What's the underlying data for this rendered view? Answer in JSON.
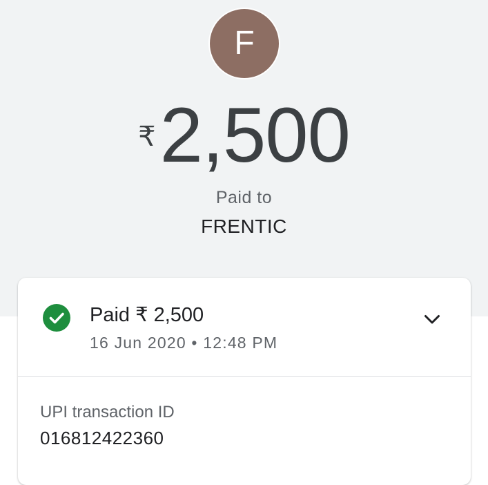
{
  "payee": {
    "avatar_initial": "F",
    "avatar_color": "#8d6e63",
    "name": "FRENTIC"
  },
  "payment": {
    "currency_symbol": "₹",
    "amount": "2,500",
    "paid_to_label": "Paid to"
  },
  "details_card": {
    "status_icon": "check-circle-icon",
    "status_color": "#1e8e3e",
    "status_title": "Paid ₹ 2,500",
    "datetime": "16 Jun 2020 • 12:48 PM",
    "expand_icon": "chevron-down-icon",
    "transaction_id_label": "UPI transaction ID",
    "transaction_id": "016812422360"
  }
}
